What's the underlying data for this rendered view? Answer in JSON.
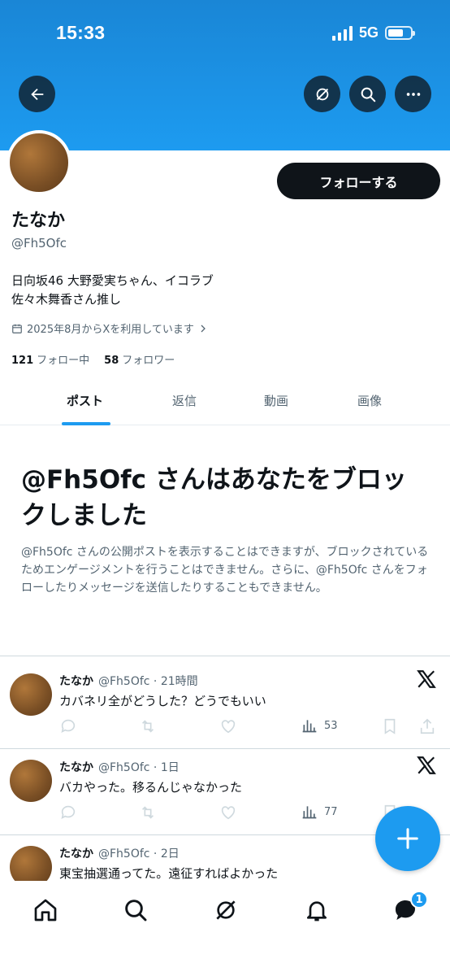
{
  "status_bar": {
    "time": "15:33",
    "network": "5G"
  },
  "header": {
    "back_icon": "back-arrow-icon",
    "grok_icon": "grok-icon",
    "search_icon": "search-icon",
    "more_icon": "more-icon"
  },
  "profile": {
    "follow_label": "フォローする",
    "name": "たなか",
    "handle": "@Fh5Ofc",
    "bio_line1": "日向坂46 大野愛実ちゃん、イコラブ",
    "bio_line2": "佐々木舞香さん推し",
    "joined": "2025年8月からXを利用しています",
    "following_count": "121",
    "following_label": "フォロー中",
    "followers_count": "58",
    "followers_label": "フォロワー"
  },
  "tabs": [
    {
      "label": "ポスト"
    },
    {
      "label": "返信"
    },
    {
      "label": "動画"
    },
    {
      "label": "画像"
    }
  ],
  "blocked": {
    "title": "@Fh5Ofc さんはあなたをブロックしました",
    "description": "@Fh5Ofc さんの公開ポストを表示することはできますが、ブロックされているためエンゲージメントを行うことはできません。さらに、@Fh5Ofc さんをフォローしたりメッセージを送信したりすることもできません。"
  },
  "posts": [
    {
      "name": "たなか",
      "handle_time": "@Fh5Ofc · 21時間",
      "text": "カバネリ全がどうした？どうでもいい",
      "views": "53"
    },
    {
      "name": "たなか",
      "handle_time": "@Fh5Ofc · 1日",
      "text": "バカやった。移るんじゃなかった",
      "views": "77"
    },
    {
      "name": "たなか",
      "handle_time": "@Fh5Ofc · 2日",
      "text": "東宝抽選通ってた。遠征すればよかった",
      "views": ""
    }
  ],
  "bottom_nav": {
    "messages_badge": "1"
  },
  "colors": {
    "accent": "#1d9bf0",
    "text": "#0f1419",
    "secondary": "#536471"
  }
}
